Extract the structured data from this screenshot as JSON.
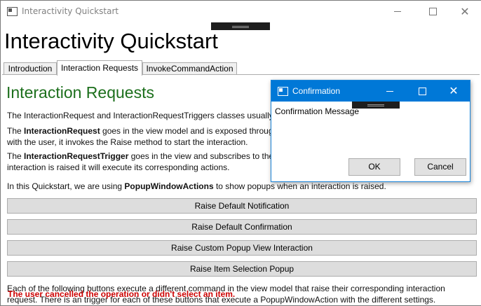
{
  "window": {
    "title": "Interactivity Quickstart",
    "controls": {
      "minimize_icon": "minimize-icon",
      "maximize_icon": "maximize-icon",
      "close_icon": "close-icon"
    }
  },
  "app": {
    "heading": "Interactivity Quickstart"
  },
  "tabs": [
    {
      "label": "Introduction",
      "selected": false
    },
    {
      "label": "Interaction Requests",
      "selected": true
    },
    {
      "label": "InvokeCommandAction",
      "selected": false
    }
  ],
  "content": {
    "heading": "Interaction Requests",
    "heading_color": "#1c6f1c",
    "p1": "The InteractionRequest and InteractionRequestTriggers classes usually w",
    "p2_bold": "InteractionRequest",
    "p2_line1_pre": "The ",
    "p2_line1_post": " goes in the view model and is exposed throug",
    "p2_line2": "with the user, it invokes the Raise method to start the interaction.",
    "p3_bold": "InteractionRequestTrigger",
    "p3_line1_pre": "The ",
    "p3_line1_post": " goes in the view and subscribes to the",
    "p3_line2": "interaction is raised it will execute its corresponding actions.",
    "p4_pre": "In this Quickstart, we are using ",
    "p4_bold": "PopupWindowActions",
    "p4_post": " to show popups when an interaction is raised.",
    "buttons": [
      "Raise Default Notification",
      "Raise Default Confirmation",
      "Raise Custom Popup View Interaction",
      "Raise Item Selection Popup"
    ],
    "p5_line1": "Each of the following buttons execute a different command in the view model that raise their corresponding interaction",
    "p5_line2": "request. There is an trigger for each of these buttons that execute a PopupWindowAction with the different settings.",
    "status_message": "The user cancelled the operation or didn't select an item.",
    "status_color": "#cc0000"
  },
  "dialog": {
    "title": "Confirmation",
    "message": "Confirmation Message",
    "ok_label": "OK",
    "cancel_label": "Cancel",
    "title_bar_color": "#0078d7"
  }
}
